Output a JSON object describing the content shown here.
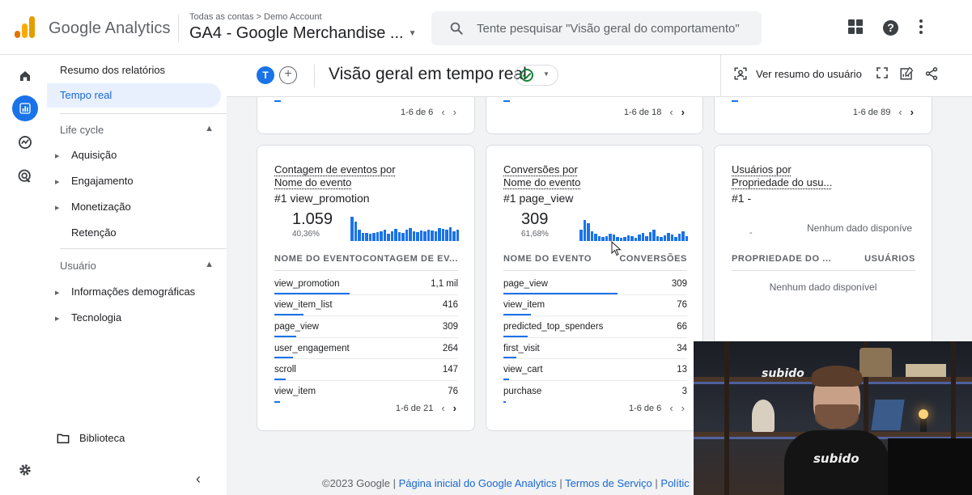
{
  "header": {
    "app_name": "Google Analytics",
    "breadcrumb": "Todas as contas > Demo Account",
    "account": "GA4 - Google Merchandise ...",
    "search_placeholder": "Tente pesquisar \"Visão geral do comportamento\""
  },
  "nav": {
    "items": [
      {
        "label": "Resumo dos relatórios"
      },
      {
        "label": "Tempo real"
      }
    ],
    "lifecycle": {
      "label": "Life cycle",
      "items": [
        "Aquisição",
        "Engajamento",
        "Monetização",
        "Retenção"
      ]
    },
    "user": {
      "label": "Usuário",
      "items": [
        "Informações demográficas",
        "Tecnologia"
      ]
    },
    "library": "Biblioteca"
  },
  "main": {
    "avatar_letter": "T",
    "add_symbol": "+",
    "title": "Visão geral em tempo real",
    "user_summary": "Ver resumo do usuário",
    "top_pagers": [
      "1-6 de 6",
      "1-6 de 18",
      "1-6 de 89"
    ],
    "cards": [
      {
        "title_line1": "Contagem de eventos por",
        "title_line2": "Nome do evento",
        "top": "#1  view_promotion",
        "big": "1.059",
        "pct": "40,36%",
        "col_left": "NOME DO EVENTO",
        "col_right": "CONTAGEM DE EV...",
        "rows": [
          {
            "name": "view_promotion",
            "value": "1,1 mil",
            "share": 0.41
          },
          {
            "name": "view_item_list",
            "value": "416",
            "share": 0.16
          },
          {
            "name": "page_view",
            "value": "309",
            "share": 0.12
          },
          {
            "name": "user_engagement",
            "value": "264",
            "share": 0.1
          },
          {
            "name": "scroll",
            "value": "147",
            "share": 0.06
          },
          {
            "name": "view_item",
            "value": "76",
            "share": 0.03
          }
        ],
        "pager": "1-6 de 21"
      },
      {
        "title_line1": "Conversões por",
        "title_line2": "Nome do evento",
        "top": "#1  page_view",
        "big": "309",
        "pct": "61,68%",
        "col_left": "NOME DO EVENTO",
        "col_right": "CONVERSÕES",
        "rows": [
          {
            "name": "page_view",
            "value": "309",
            "share": 0.62
          },
          {
            "name": "view_item",
            "value": "76",
            "share": 0.15
          },
          {
            "name": "predicted_top_spenders",
            "value": "66",
            "share": 0.13
          },
          {
            "name": "first_visit",
            "value": "34",
            "share": 0.07
          },
          {
            "name": "view_cart",
            "value": "13",
            "share": 0.03
          },
          {
            "name": "purchase",
            "value": "3",
            "share": 0.01
          }
        ],
        "pager": "1-6 de 6"
      },
      {
        "title_line1": "Usuários por",
        "title_line2": "Propriedade do usu...",
        "top": "#1  -",
        "dash": "-",
        "empty_top": "Nenhum dado disponíve",
        "col_left": "PROPRIEDADE DO ...",
        "col_right": "USUÁRIOS",
        "empty": "Nenhum dado disponível"
      }
    ]
  },
  "footer": {
    "copyright": "©2023 Google | ",
    "link1": "Página inicial do Google Analytics",
    "sep": " | ",
    "link2": "Termos de Serviço",
    "link3": "Polític"
  },
  "webcam": {
    "brand_wall": "subido",
    "brand_shirt": "subido"
  },
  "colors": {
    "accent": "#1a73e8",
    "logo_orange": "#e37400",
    "logo_yellow": "#f9ab00",
    "status_green": "#188038"
  }
}
